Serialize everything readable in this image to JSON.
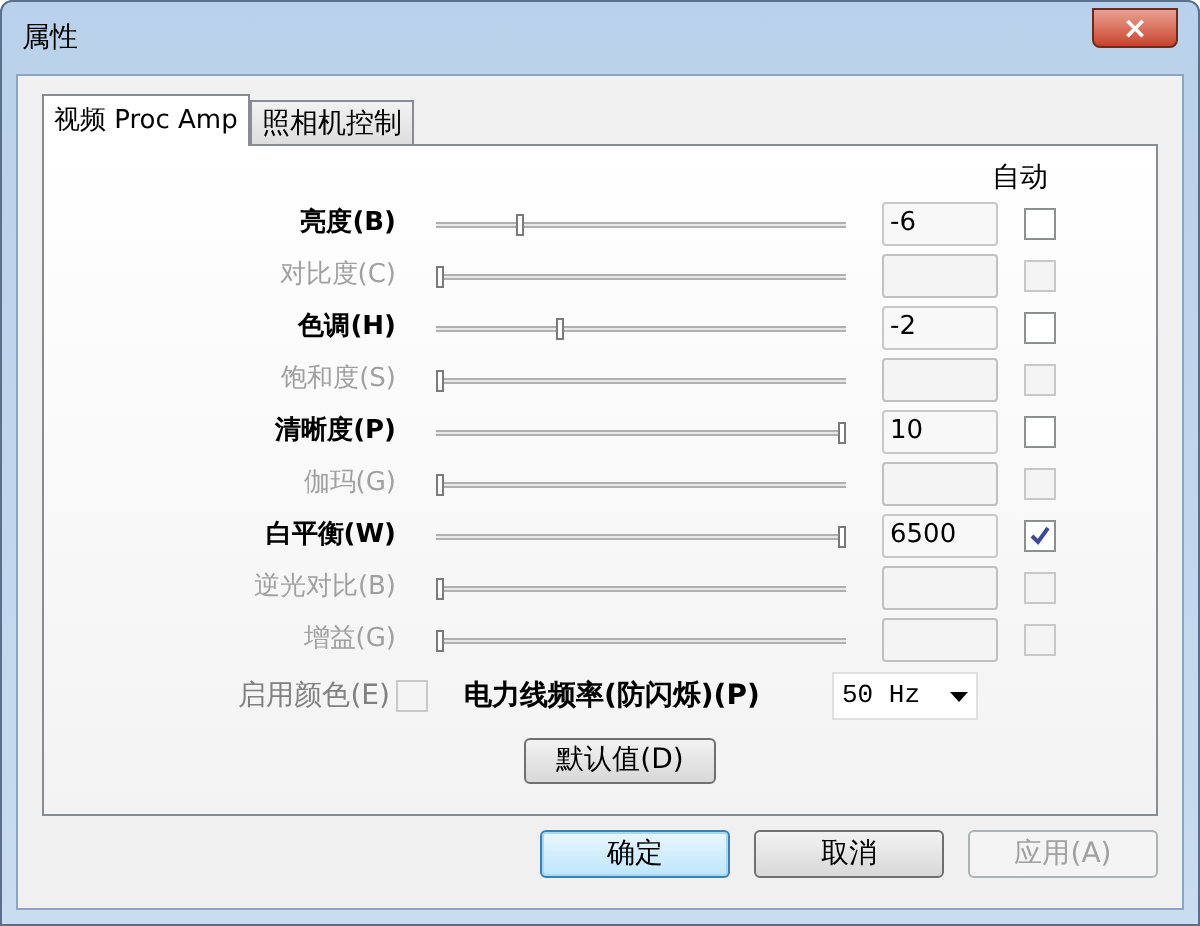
{
  "window": {
    "title": "属性",
    "close_label": "×"
  },
  "tabs": [
    {
      "label": "视频 Proc Amp",
      "selected": true
    },
    {
      "label": "照相机控制",
      "selected": false
    }
  ],
  "auto_header": "自动",
  "controls": [
    {
      "label": "亮度(B)",
      "disabled": false,
      "level": 0.2,
      "value": "-6",
      "auto": false
    },
    {
      "label": "对比度(C)",
      "disabled": true,
      "level": 0,
      "auto": false
    },
    {
      "label": "色调(H)",
      "disabled": false,
      "level": 0.3,
      "value": "-2",
      "auto": false
    },
    {
      "label": "饱和度(S)",
      "disabled": true,
      "level": 0,
      "auto": false
    },
    {
      "label": "清晰度(P)",
      "disabled": false,
      "level": 1,
      "value": "10",
      "auto": false
    },
    {
      "label": "伽玛(G)",
      "disabled": true,
      "level": 0,
      "auto": false
    },
    {
      "label": "白平衡(W)",
      "disabled": false,
      "level": 1,
      "value": "6500",
      "auto": true
    },
    {
      "label": "逆光对比(B)",
      "disabled": true,
      "level": 0,
      "auto": false
    },
    {
      "label": "增益(G)",
      "disabled": true,
      "level": 0,
      "auto": false
    }
  ],
  "color_enable": {
    "label": "启用颜色(E)",
    "checked": false,
    "disabled": true
  },
  "powerline": {
    "label": "电力线频率(防闪烁)(P)",
    "value": "50 Hz"
  },
  "default_button": "默认值(D)",
  "buttons": [
    {
      "label": "确定",
      "kind": "default",
      "disabled": false
    },
    {
      "label": "取消",
      "kind": "normal",
      "disabled": false
    },
    {
      "label": "应用(A)",
      "kind": "normal",
      "disabled": true
    }
  ]
}
